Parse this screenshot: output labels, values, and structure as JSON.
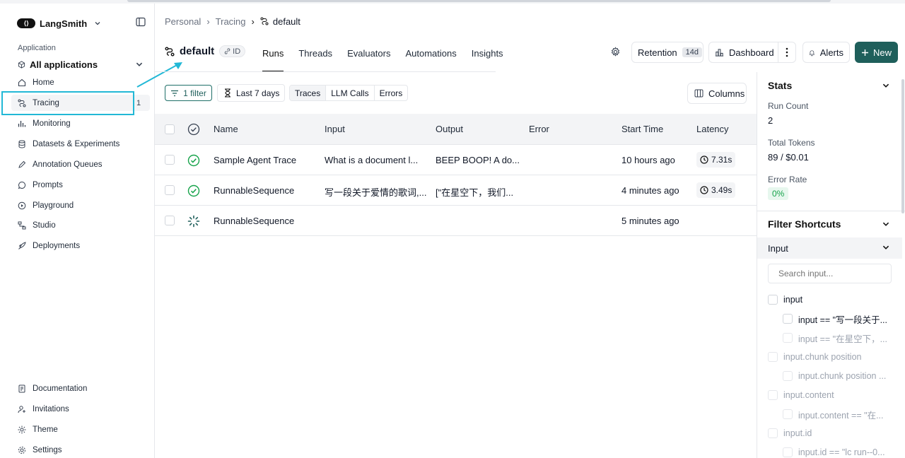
{
  "brand": {
    "name": "LangSmith"
  },
  "sidebar": {
    "section_label": "Application",
    "app_select": "All applications",
    "items": [
      {
        "label": "Home",
        "icon": "home-icon"
      },
      {
        "label": "Tracing",
        "icon": "tracing-icon",
        "badge": "1"
      },
      {
        "label": "Monitoring",
        "icon": "monitoring-icon"
      },
      {
        "label": "Datasets & Experiments",
        "icon": "database-icon"
      },
      {
        "label": "Annotation Queues",
        "icon": "pencil-icon"
      },
      {
        "label": "Prompts",
        "icon": "chat-icon"
      },
      {
        "label": "Playground",
        "icon": "play-icon"
      },
      {
        "label": "Studio",
        "icon": "studio-icon"
      },
      {
        "label": "Deployments",
        "icon": "rocket-icon"
      }
    ],
    "bottom_items": [
      {
        "label": "Documentation",
        "icon": "document-icon"
      },
      {
        "label": "Invitations",
        "icon": "user-plus-icon"
      },
      {
        "label": "Theme",
        "icon": "sun-icon"
      },
      {
        "label": "Settings",
        "icon": "gear-icon"
      }
    ]
  },
  "breadcrumb": [
    "Personal",
    "Tracing",
    "default"
  ],
  "project": {
    "title": "default",
    "id_label": "ID"
  },
  "tabs": [
    "Runs",
    "Threads",
    "Evaluators",
    "Automations",
    "Insights"
  ],
  "toolbar": {
    "retention_label": "Retention",
    "retention_value": "14d",
    "dashboard_label": "Dashboard",
    "alerts_label": "Alerts",
    "new_label": "New"
  },
  "filters": {
    "filter_label": "1 filter",
    "range_label": "Last 7 days",
    "segments": [
      "Traces",
      "LLM Calls",
      "Errors"
    ],
    "columns_label": "Columns"
  },
  "table": {
    "headers": [
      "Name",
      "Input",
      "Output",
      "Error",
      "Start Time",
      "Latency"
    ],
    "rows": [
      {
        "status": "success",
        "name": "Sample Agent Trace",
        "input": "What is a document l...",
        "output": "BEEP BOOP! A do...",
        "error": "",
        "start": "10 hours ago",
        "latency": "7.31s"
      },
      {
        "status": "success",
        "name": "RunnableSequence",
        "input": "写一段关于爱情的歌词,...",
        "output": "[\"在星空下，我们...",
        "error": "",
        "start": "4 minutes ago",
        "latency": "3.49s"
      },
      {
        "status": "running",
        "name": "RunnableSequence",
        "input": "",
        "output": "",
        "error": "",
        "start": "5 minutes ago",
        "latency": ""
      }
    ]
  },
  "stats": {
    "title": "Stats",
    "run_count_label": "Run Count",
    "run_count": "2",
    "tokens_label": "Total Tokens",
    "tokens": "89 / $0.01",
    "error_rate_label": "Error Rate",
    "error_rate": "0%"
  },
  "shortcuts": {
    "title": "Filter Shortcuts",
    "input_section": "Input",
    "search_placeholder": "Search input...",
    "items": [
      {
        "label": "input",
        "level": 0,
        "dim": false
      },
      {
        "label": "input == \"写一段关于...",
        "level": 1,
        "dim": false
      },
      {
        "label": "input == \"在星空下，...",
        "level": 1,
        "dim": true
      },
      {
        "label": "input.chunk position",
        "level": 0,
        "dim": true
      },
      {
        "label": "input.chunk position ...",
        "level": 1,
        "dim": true
      },
      {
        "label": "input.content",
        "level": 0,
        "dim": true
      },
      {
        "label": "input.content == \"在...",
        "level": 1,
        "dim": true
      },
      {
        "label": "input.id",
        "level": 0,
        "dim": true
      },
      {
        "label": "input.id == \"lc run--0...",
        "level": 1,
        "dim": true
      }
    ]
  },
  "colors": {
    "accent": "#1f5f5b",
    "highlight": "#22b8d6",
    "success": "#16a34a"
  }
}
